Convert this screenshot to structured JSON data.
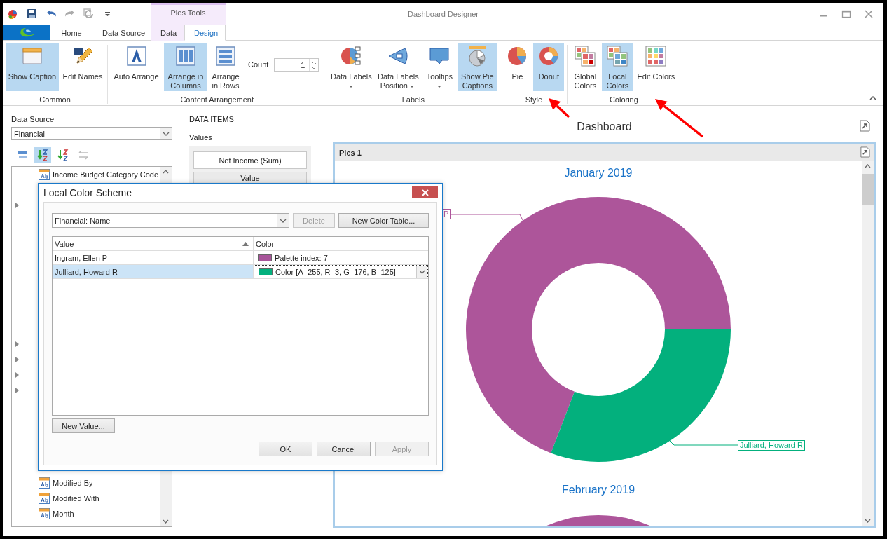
{
  "window": {
    "title": "Dashboard Designer",
    "contextual_group": "Pies Tools"
  },
  "tabs": [
    {
      "label": "Home",
      "selected": false,
      "contextual": false
    },
    {
      "label": "Data Source",
      "selected": false,
      "contextual": false
    },
    {
      "label": "Data",
      "selected": false,
      "contextual": true
    },
    {
      "label": "Design",
      "selected": true,
      "contextual": true
    }
  ],
  "ribbon": {
    "groups": [
      {
        "title": "Common",
        "items": [
          {
            "kind": "large",
            "label": "Show Caption",
            "selected": true
          },
          {
            "kind": "large",
            "label": "Edit Names",
            "selected": false
          }
        ]
      },
      {
        "title": "Content Arrangement",
        "items": [
          {
            "kind": "large",
            "label": "Auto Arrange",
            "selected": false
          },
          {
            "kind": "large",
            "label": "Arrange in Columns",
            "selected": true
          },
          {
            "kind": "large",
            "label": "Arrange in Rows",
            "selected": false
          },
          {
            "kind": "spin",
            "label": "Count",
            "value": "1"
          }
        ]
      },
      {
        "title": "Labels",
        "items": [
          {
            "kind": "dropdown",
            "label": "Data Labels",
            "selected": false
          },
          {
            "kind": "dropdown",
            "label": "Data Labels Position",
            "selected": false
          },
          {
            "kind": "dropdown",
            "label": "Tooltips",
            "selected": false
          },
          {
            "kind": "large",
            "label": "Show Pie Captions",
            "selected": true
          }
        ]
      },
      {
        "title": "Style",
        "items": [
          {
            "kind": "large",
            "label": "Pie",
            "selected": false
          },
          {
            "kind": "large",
            "label": "Donut",
            "selected": true
          }
        ]
      },
      {
        "title": "Coloring",
        "items": [
          {
            "kind": "large",
            "label": "Global Colors",
            "selected": false
          },
          {
            "kind": "large",
            "label": "Local Colors",
            "selected": true
          },
          {
            "kind": "large",
            "label": "Edit Colors",
            "selected": false
          }
        ]
      }
    ]
  },
  "data_source": {
    "label": "Data Source",
    "value": "Financial"
  },
  "field_tools": [
    {
      "selected": false,
      "disabled": false
    },
    {
      "selected": true,
      "disabled": false
    },
    {
      "selected": false,
      "disabled": false
    },
    {
      "selected": false,
      "disabled": true
    }
  ],
  "fields": [
    {
      "kind": "field",
      "label": "Income Budget Category Code"
    },
    {
      "kind": "covered"
    },
    {
      "kind": "group",
      "expanded": false
    },
    {
      "kind": "covered"
    },
    {
      "kind": "covered"
    },
    {
      "kind": "covered"
    },
    {
      "kind": "covered"
    },
    {
      "kind": "covered"
    },
    {
      "kind": "covered"
    },
    {
      "kind": "covered"
    },
    {
      "kind": "covered"
    },
    {
      "kind": "group",
      "expanded": false
    },
    {
      "kind": "group",
      "expanded": false
    },
    {
      "kind": "group",
      "expanded": false
    },
    {
      "kind": "group",
      "expanded": false
    },
    {
      "kind": "covered"
    },
    {
      "kind": "covered"
    },
    {
      "kind": "covered"
    },
    {
      "kind": "covered"
    },
    {
      "kind": "covered"
    },
    {
      "kind": "field",
      "label": "Modified By"
    },
    {
      "kind": "field",
      "label": "Modified With"
    },
    {
      "kind": "field",
      "label": "Month"
    }
  ],
  "data_items": {
    "title": "DATA ITEMS",
    "section": "Values",
    "items": [
      "Net Income (Sum)",
      "Value"
    ]
  },
  "dashboard": {
    "title": "Dashboard",
    "panel": {
      "caption": "Pies 1",
      "pies": [
        {
          "title": "January 2019",
          "slices": [
            {
              "label": "P",
              "color": "#ad559a"
            },
            {
              "label": "Julliard, Howard R",
              "color": "#03b07d"
            }
          ]
        },
        {
          "title": "February 2019",
          "slices": [
            {
              "color": "#ad559a"
            }
          ]
        }
      ]
    }
  },
  "dialog": {
    "title": "Local Color Scheme",
    "table_select": "Financial: Name",
    "buttons_top": [
      {
        "label": "Delete",
        "disabled": true
      },
      {
        "label": "New Color Table...",
        "disabled": false
      }
    ],
    "columns": [
      {
        "label": "Value",
        "sorted": true
      },
      {
        "label": "Color",
        "sorted": false
      }
    ],
    "rows": [
      {
        "value": "Ingram, Ellen P",
        "color_text": "Palette index: 7",
        "color": "#a8559a",
        "selected": false
      },
      {
        "value": "Julliard, Howard R",
        "color_text": "Color [A=255, R=3, G=176, B=125]",
        "color": "#03b07d",
        "selected": true
      }
    ],
    "new_value": "New Value...",
    "buttons": [
      {
        "label": "OK",
        "disabled": false
      },
      {
        "label": "Cancel",
        "disabled": false
      },
      {
        "label": "Apply",
        "disabled": true
      }
    ]
  },
  "annotations": [
    {
      "kind": "arrow"
    },
    {
      "kind": "arrow"
    }
  ]
}
